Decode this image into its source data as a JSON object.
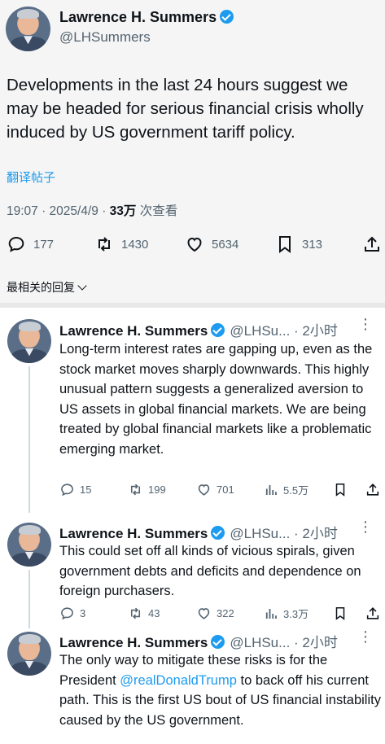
{
  "main_tweet": {
    "author_name": "Lawrence H. Summers",
    "handle": "@LHSummers",
    "text": "Developments in the last 24 hours suggest we may be headed for serious financial crisis wholly induced by US government tariff policy.",
    "translate_label": "翻译帖子",
    "timestamp": "19:07 · 2025/4/9 · ",
    "views_count": "33万",
    "views_label": " 次查看",
    "replies": "177",
    "reposts": "1430",
    "likes": "5634",
    "bookmarks": "313"
  },
  "sort_label": "最相关的回复",
  "replies": [
    {
      "author_name": "Lawrence H. Summers",
      "handle_time": "@LHSu... · 2小时",
      "text": "Long-term interest rates are gapping up, even as the stock market moves sharply downwards. This highly unusual pattern suggests a generalized aversion to US assets in global financial markets.  We are being treated by global financial markets like a problematic emerging market.",
      "replies": "15",
      "reposts": "199",
      "likes": "701",
      "views": "5.5万"
    },
    {
      "author_name": "Lawrence H. Summers",
      "handle_time": "@LHSu... · 2小时",
      "text": "This could set off all kinds of vicious spirals, given government debts and deficits and dependence on foreign purchasers.",
      "replies": "3",
      "reposts": "43",
      "likes": "322",
      "views": "3.3万"
    },
    {
      "author_name": "Lawrence H. Summers",
      "handle_time": "@LHSu... · 2小时",
      "text_before": "The only way to mitigate these risks is for the President ",
      "mention": "@realDonaldTrump",
      "text_after": " to back off his current path. This is the first US bout of US financial instability caused by the US government."
    }
  ],
  "colors": {
    "accent": "#1d9bf0",
    "muted": "#536471",
    "text": "#0f1419"
  }
}
